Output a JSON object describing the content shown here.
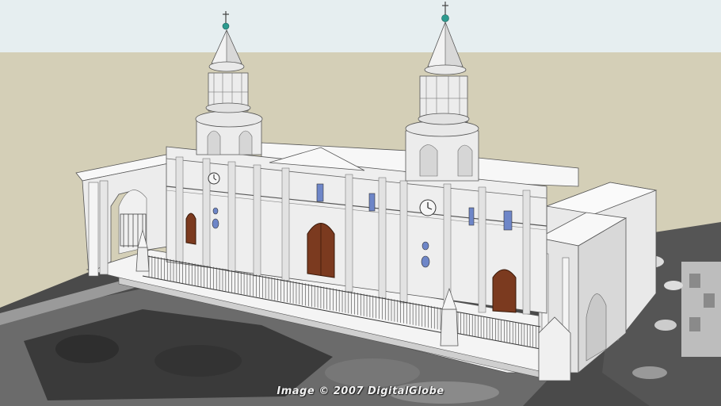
{
  "viewport": {
    "attribution": "Image © 2007 DigitalGlobe"
  },
  "colors": {
    "sky": "#e6eef0",
    "ground_plane": "#d4cfb7",
    "aerial_dark": "#3a3a3a",
    "facade": "#eeeeee",
    "facade_shadow": "#cfcfcf",
    "door": "#7b3a1f",
    "window": "#6e86c8",
    "finial": "#2c9a8f",
    "outline": "#444444"
  },
  "icons": [
    "clock-icon",
    "cross-icon"
  ]
}
